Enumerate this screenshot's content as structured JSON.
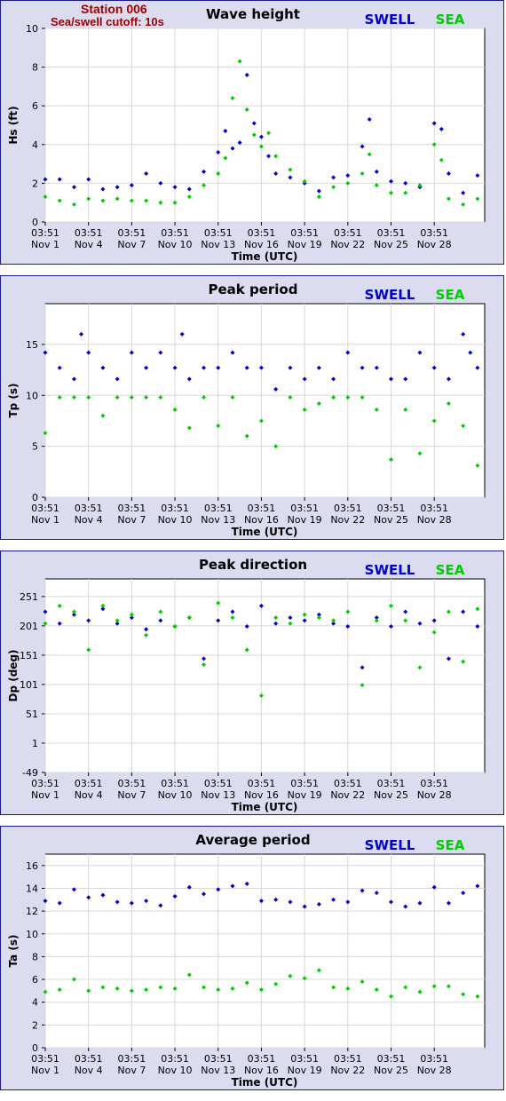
{
  "header": {
    "station": "Station 006",
    "cutoff": "Sea/swell cutoff: 10s"
  },
  "legend": {
    "swell": "SWELL",
    "sea": "SEA"
  },
  "colors": {
    "swell": "#0000cc",
    "sea": "#00cc00",
    "title": "#000000",
    "header": "#990000"
  },
  "x_ticks": [
    {
      "time": "03:51",
      "date": "Nov 1"
    },
    {
      "time": "03:51",
      "date": "Nov 4"
    },
    {
      "time": "03:51",
      "date": "Nov 7"
    },
    {
      "time": "03:51",
      "date": "Nov 10"
    },
    {
      "time": "03:51",
      "date": "Nov 13"
    },
    {
      "time": "03:51",
      "date": "Nov 16"
    },
    {
      "time": "03:51",
      "date": "Nov 19"
    },
    {
      "time": "03:51",
      "date": "Nov 22"
    },
    {
      "time": "03:51",
      "date": "Nov 25"
    },
    {
      "time": "03:51",
      "date": "Nov 28"
    }
  ],
  "chart_data": [
    {
      "type": "scatter",
      "title": "Wave height",
      "xlabel": "Time (UTC)",
      "ylabel": "Hs (ft)",
      "ylim": [
        0,
        10
      ],
      "yticks": [
        0,
        2,
        4,
        6,
        8,
        10
      ],
      "x_unit": "days since Nov 1 03:51 UTC",
      "xlim": [
        0,
        30.5
      ],
      "grid": true,
      "legend": "top-right",
      "series": [
        {
          "name": "SWELL",
          "x": [
            0,
            1,
            2,
            3,
            4,
            5,
            6,
            7,
            8,
            9,
            10,
            11,
            12,
            12.5,
            13,
            13.5,
            14,
            14.5,
            15,
            15.5,
            16,
            17,
            18,
            19,
            20,
            21,
            22,
            22.5,
            23,
            24,
            25,
            26,
            27,
            27.5,
            28,
            29,
            30
          ],
          "y": [
            2.2,
            2.2,
            1.8,
            2.2,
            1.7,
            1.8,
            1.9,
            2.5,
            2.0,
            1.8,
            1.7,
            2.6,
            3.6,
            4.7,
            3.8,
            4.1,
            7.6,
            5.1,
            4.4,
            3.4,
            2.5,
            2.3,
            2.0,
            1.6,
            2.3,
            2.4,
            3.9,
            5.3,
            2.6,
            2.1,
            2.0,
            1.8,
            5.1,
            4.8,
            2.5,
            1.5,
            2.4
          ]
        },
        {
          "name": "SEA",
          "x": [
            0,
            1,
            2,
            3,
            4,
            5,
            6,
            7,
            8,
            9,
            10,
            11,
            12,
            12.5,
            13,
            13.5,
            14,
            14.5,
            15,
            15.5,
            16,
            17,
            18,
            19,
            20,
            21,
            22,
            22.5,
            23,
            24,
            25,
            26,
            27,
            27.5,
            28,
            29,
            30
          ],
          "y": [
            1.3,
            1.1,
            0.9,
            1.2,
            1.1,
            1.2,
            1.1,
            1.1,
            1.0,
            1.0,
            1.3,
            1.9,
            2.5,
            3.3,
            6.4,
            8.3,
            5.8,
            4.5,
            3.9,
            4.6,
            3.4,
            2.7,
            2.1,
            1.3,
            1.8,
            2.0,
            2.5,
            3.5,
            1.9,
            1.5,
            1.5,
            1.9,
            4.0,
            3.2,
            1.2,
            0.9,
            1.2
          ]
        }
      ]
    },
    {
      "type": "scatter",
      "title": "Peak period",
      "xlabel": "Time (UTC)",
      "ylabel": "Tp (s)",
      "ylim": [
        0,
        19
      ],
      "yticks": [
        0,
        5,
        10,
        15
      ],
      "x_unit": "days since Nov 1 03:51 UTC",
      "xlim": [
        0,
        30.5
      ],
      "grid": true,
      "legend": "top-right",
      "series": [
        {
          "name": "SWELL",
          "x": [
            0,
            1,
            2,
            2.5,
            3,
            4,
            5,
            6,
            7,
            8,
            9,
            9.5,
            10,
            11,
            12,
            13,
            14,
            15,
            16,
            17,
            18,
            19,
            20,
            21,
            22,
            23,
            24,
            25,
            26,
            27,
            28,
            29,
            29.5,
            30
          ],
          "y": [
            14.2,
            12.7,
            11.6,
            16.0,
            14.2,
            12.7,
            11.6,
            14.2,
            12.7,
            14.2,
            12.7,
            16.0,
            11.6,
            12.7,
            12.7,
            14.2,
            12.7,
            12.7,
            10.6,
            12.7,
            11.6,
            12.7,
            11.6,
            14.2,
            12.7,
            12.7,
            11.6,
            11.6,
            14.2,
            12.7,
            11.6,
            16.0,
            14.2,
            12.7
          ]
        },
        {
          "name": "SEA",
          "x": [
            0,
            1,
            2,
            3,
            4,
            5,
            6,
            7,
            8,
            9,
            10,
            11,
            12,
            13,
            14,
            15,
            16,
            17,
            18,
            19,
            20,
            21,
            22,
            23,
            24,
            25,
            26,
            27,
            28,
            29,
            30
          ],
          "y": [
            6.3,
            9.8,
            9.8,
            9.8,
            8.0,
            9.8,
            9.8,
            9.8,
            9.8,
            8.6,
            6.8,
            9.8,
            7.0,
            9.8,
            6.0,
            7.5,
            5.0,
            9.8,
            8.6,
            9.2,
            9.8,
            9.8,
            9.8,
            8.6,
            3.7,
            8.6,
            4.3,
            7.5,
            9.2,
            7.0,
            3.1
          ]
        }
      ]
    },
    {
      "type": "scatter",
      "title": "Peak direction",
      "xlabel": "Time (UTC)",
      "ylabel": "Dp (deg)",
      "ylim": [
        -49,
        281
      ],
      "yticks": [
        -49,
        1,
        51,
        101,
        151,
        201,
        251
      ],
      "x_unit": "days since Nov 1 03:51 UTC",
      "xlim": [
        0,
        30.5
      ],
      "grid": true,
      "legend": "top-right",
      "series": [
        {
          "name": "SWELL",
          "x": [
            0,
            1,
            2,
            3,
            4,
            5,
            6,
            7,
            8,
            9,
            10,
            11,
            12,
            13,
            14,
            15,
            16,
            17,
            18,
            19,
            20,
            21,
            22,
            23,
            24,
            25,
            26,
            27,
            28,
            29,
            30
          ],
          "y": [
            225,
            205,
            220,
            210,
            230,
            205,
            215,
            195,
            210,
            200,
            215,
            145,
            210,
            225,
            200,
            235,
            205,
            215,
            210,
            220,
            205,
            200,
            130,
            215,
            200,
            225,
            205,
            210,
            145,
            225,
            200
          ]
        },
        {
          "name": "SEA",
          "x": [
            0,
            1,
            2,
            3,
            4,
            5,
            6,
            7,
            8,
            9,
            10,
            11,
            12,
            13,
            14,
            15,
            16,
            17,
            18,
            19,
            20,
            21,
            22,
            23,
            24,
            25,
            26,
            27,
            28,
            29,
            30
          ],
          "y": [
            205,
            235,
            225,
            160,
            235,
            210,
            220,
            185,
            225,
            200,
            215,
            135,
            240,
            215,
            160,
            82,
            215,
            205,
            220,
            215,
            210,
            225,
            100,
            210,
            235,
            210,
            130,
            190,
            225,
            140,
            230
          ]
        }
      ]
    },
    {
      "type": "scatter",
      "title": "Average period",
      "xlabel": "Time (UTC)",
      "ylabel": "Ta (s)",
      "ylim": [
        0,
        17
      ],
      "yticks": [
        0,
        2,
        4,
        6,
        8,
        10,
        12,
        14,
        16
      ],
      "x_unit": "days since Nov 1 03:51 UTC",
      "xlim": [
        0,
        30.5
      ],
      "grid": true,
      "legend": "top-right",
      "series": [
        {
          "name": "SWELL",
          "x": [
            0,
            1,
            2,
            3,
            4,
            5,
            6,
            7,
            8,
            9,
            10,
            11,
            12,
            13,
            14,
            15,
            16,
            17,
            18,
            19,
            20,
            21,
            22,
            23,
            24,
            25,
            26,
            27,
            28,
            29,
            30
          ],
          "y": [
            12.9,
            12.7,
            13.9,
            13.2,
            13.4,
            12.8,
            12.7,
            12.9,
            12.5,
            13.3,
            14.1,
            13.5,
            13.9,
            14.2,
            14.4,
            12.9,
            13.0,
            12.8,
            12.4,
            12.6,
            13.0,
            12.8,
            13.8,
            13.6,
            12.8,
            12.4,
            12.7,
            14.1,
            12.7,
            13.6,
            14.2
          ]
        },
        {
          "name": "SEA",
          "x": [
            0,
            1,
            2,
            3,
            4,
            5,
            6,
            7,
            8,
            9,
            10,
            11,
            12,
            13,
            14,
            15,
            16,
            17,
            18,
            19,
            20,
            21,
            22,
            23,
            24,
            25,
            26,
            27,
            28,
            29,
            30
          ],
          "y": [
            4.9,
            5.1,
            6.0,
            5.0,
            5.3,
            5.2,
            5.0,
            5.1,
            5.3,
            5.2,
            6.4,
            5.3,
            5.1,
            5.2,
            5.7,
            5.1,
            5.6,
            6.3,
            6.1,
            6.8,
            5.3,
            5.2,
            5.8,
            5.1,
            4.5,
            5.3,
            4.9,
            5.4,
            5.4,
            4.7,
            4.5
          ]
        }
      ]
    }
  ]
}
